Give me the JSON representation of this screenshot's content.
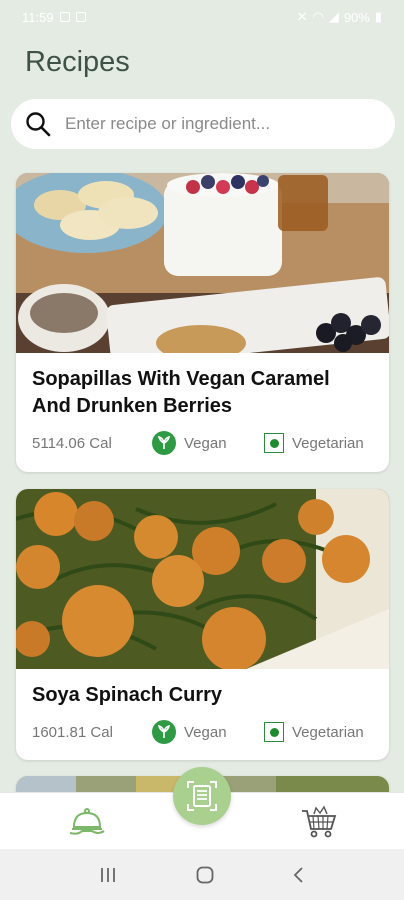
{
  "status_bar": {
    "time": "11:59",
    "battery": "90%"
  },
  "page": {
    "title": "Recipes"
  },
  "search": {
    "placeholder": "Enter recipe or ingredient..."
  },
  "recipes": [
    {
      "title": "Sopapillas With Vegan Caramel And Drunken Berries",
      "calories": "5114.06 Cal",
      "tag_vegan": "Vegan",
      "tag_vegetarian": "Vegetarian"
    },
    {
      "title": "Soya Spinach Curry",
      "calories": "1601.81 Cal",
      "tag_vegan": "Vegan",
      "tag_vegetarian": "Vegetarian"
    }
  ],
  "icons": {
    "search": "search-icon",
    "home": "serving-dish-icon",
    "scan": "receipt-icon",
    "cart": "grocery-cart-icon",
    "vegan": "leaf-icon",
    "vegetarian": "veg-dot-icon"
  },
  "colors": {
    "background": "#e4ebe3",
    "title": "#3e5247",
    "vegan_green": "#2e9a44",
    "fab": "#a9d08e"
  }
}
